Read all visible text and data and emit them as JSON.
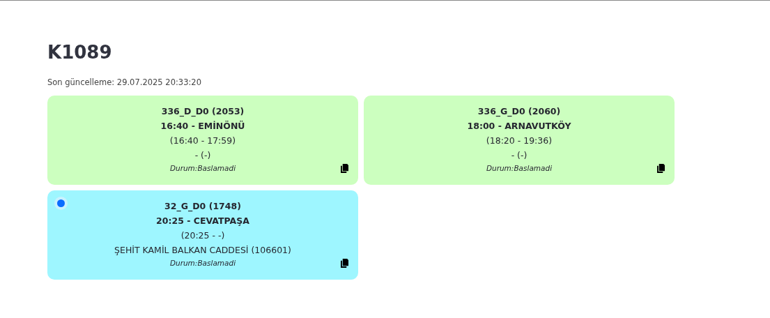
{
  "title": "K1089",
  "last_update": "Son güncelleme: 29.07.2025 20:33:20",
  "trips": [
    {
      "route": "336_D_D0 (2053)",
      "departure": "16:40 - EMİNÖNÜ",
      "times": "(16:40 - 17:59)",
      "stop": "- (-)",
      "status": "Durum:Baslamadi",
      "active": false
    },
    {
      "route": "336_G_D0 (2060)",
      "departure": "18:00 - ARNAVUTKÖY",
      "times": "(18:20 - 19:36)",
      "stop": "- (-)",
      "status": "Durum:Baslamadi",
      "active": false
    },
    {
      "route": "32_G_D0 (1748)",
      "departure": "20:25 - CEVATPAŞA",
      "times": "(20:25 - -)",
      "stop": "ŞEHİT KAMİL BALKAN CADDESİ (106601)",
      "status": "Durum:Baslamadi",
      "active": true
    }
  ]
}
